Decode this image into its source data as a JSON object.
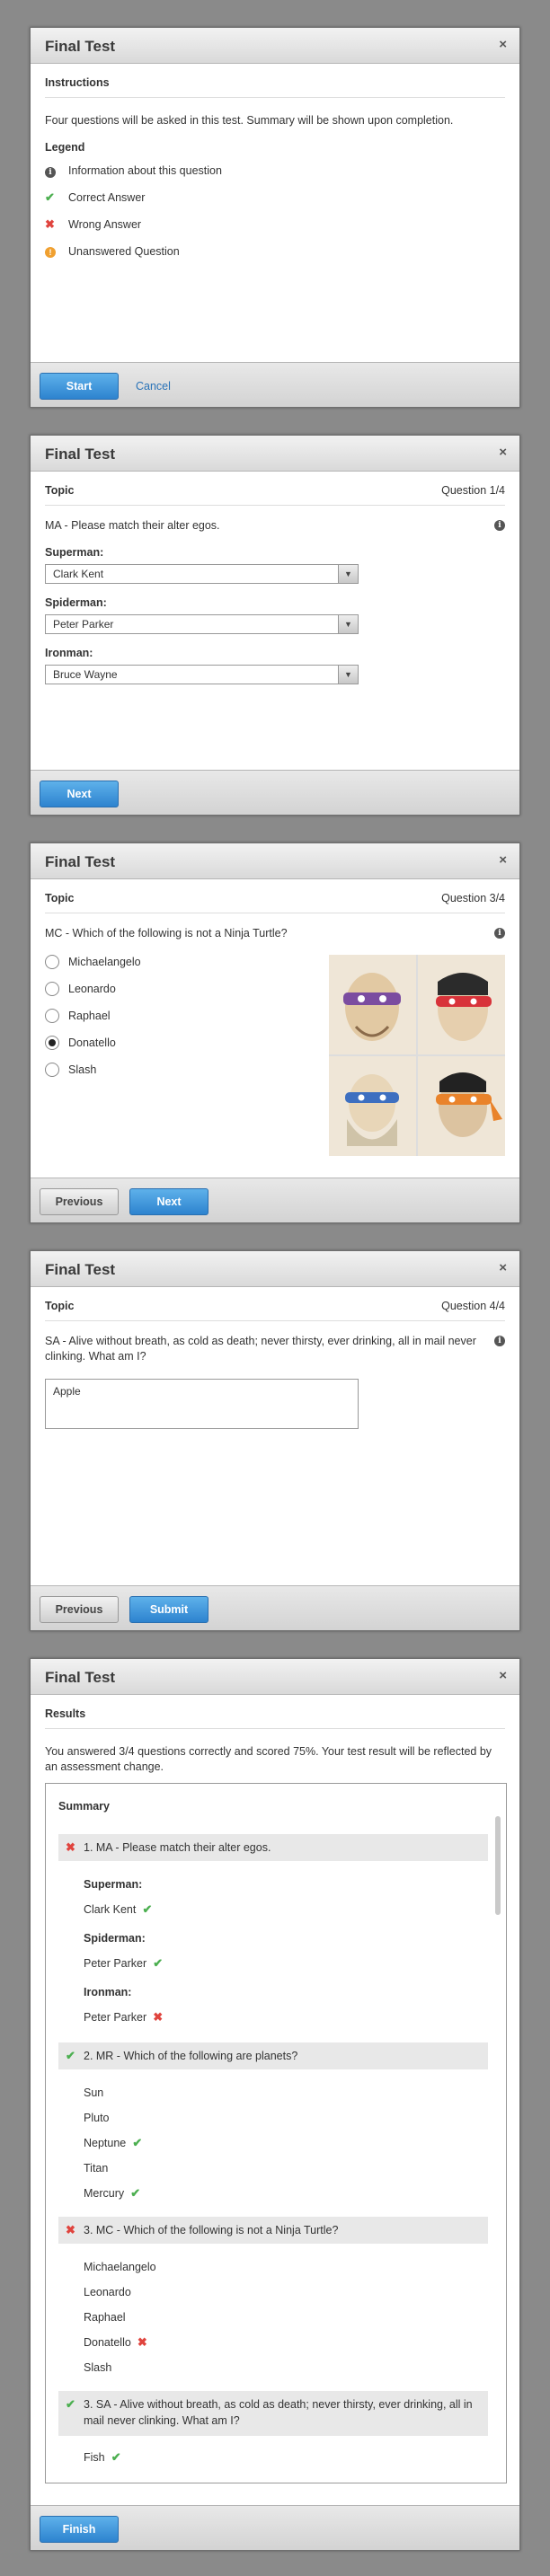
{
  "dialog_title": "Final Test",
  "close_glyph": "×",
  "d1": {
    "section": "Instructions",
    "desc": "Four questions will be asked in this test. Summary will be shown upon completion.",
    "legend_title": "Legend",
    "legend": [
      {
        "icon": "info-icon",
        "label": "Information about this question"
      },
      {
        "icon": "check-icon",
        "label": "Correct Answer"
      },
      {
        "icon": "x-icon",
        "label": "Wrong Answer"
      },
      {
        "icon": "warning-icon",
        "label": "Unanswered Question"
      }
    ],
    "start": "Start",
    "cancel": "Cancel"
  },
  "d2": {
    "section": "Topic",
    "counter": "Question 1/4",
    "question": "MA - Please match their alter egos.",
    "fields": [
      {
        "label": "Superman:",
        "value": "Clark Kent"
      },
      {
        "label": "Spiderman:",
        "value": "Peter Parker"
      },
      {
        "label": "Ironman:",
        "value": "Bruce Wayne"
      }
    ],
    "next": "Next"
  },
  "d3": {
    "section": "Topic",
    "counter": "Question 3/4",
    "question": "MC - Which of the following is not a Ninja Turtle?",
    "options": [
      "Michaelangelo",
      "Leonardo",
      "Raphael",
      "Donatello",
      "Slash"
    ],
    "selected_index": 3,
    "previous": "Previous",
    "next": "Next",
    "turtle_colors": [
      "#7b4ca0",
      "#d8333a",
      "#3d6fc0",
      "#e9832b"
    ]
  },
  "d4": {
    "section": "Topic",
    "counter": "Question 4/4",
    "question": "SA - Alive without breath, as cold as death; never thirsty, ever drinking, all in mail never clinking. What am I?",
    "answer": "Apple",
    "previous": "Previous",
    "submit": "Submit"
  },
  "d5": {
    "section": "Results",
    "result": "You answered 3/4 questions correctly and scored 75%. Your test result will be reflected by an assessment change.",
    "summary_title": "Summary",
    "q1": {
      "title": "1. MA - Please match their alter egos.",
      "status": "wrong",
      "l1": "Superman:",
      "a1": "Clark Kent",
      "l2": "Spiderman:",
      "a2": "Peter Parker",
      "l3": "Ironman:",
      "a3": "Peter Parker"
    },
    "q2": {
      "title": "2. MR - Which of the following are planets?",
      "status": "correct",
      "o1": "Sun",
      "o2": "Pluto",
      "o3": "Neptune",
      "o4": "Titan",
      "o5": "Mercury"
    },
    "q3": {
      "title": "3. MC - Which of the following is not a Ninja Turtle?",
      "status": "wrong",
      "o1": "Michaelangelo",
      "o2": "Leonardo",
      "o3": "Raphael",
      "o4": "Donatello",
      "o5": "Slash"
    },
    "q4": {
      "title": "3. SA - Alive without breath, as cold as death; never thirsty, ever drinking, all in mail never clinking. What am I?",
      "status": "correct",
      "answer": "Fish"
    },
    "finish": "Finish"
  },
  "colors": {
    "accent": "#2d83cf",
    "correct": "#4caf50",
    "wrong": "#e0443e",
    "warning": "#f0a030"
  }
}
